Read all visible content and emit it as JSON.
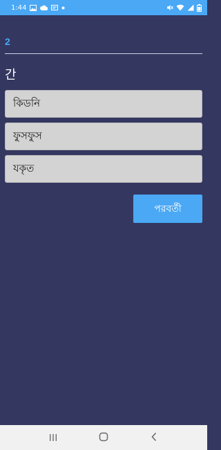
{
  "status_bar": {
    "time": "1:44",
    "left_icons": [
      "image-icon",
      "cloud-icon",
      "notification-icon",
      "dot-icon"
    ],
    "right_icons": [
      "mute-icon",
      "wifi-icon",
      "signal-icon",
      "battery-icon"
    ]
  },
  "quiz": {
    "question_number": "2",
    "question_text": "간",
    "options": [
      {
        "label": "কিডনি"
      },
      {
        "label": "ফুসফুস"
      },
      {
        "label": "যকৃত"
      }
    ],
    "next_label": "পরবর্তী"
  },
  "nav_bar": {
    "buttons": [
      "recent-apps-icon",
      "home-icon",
      "back-icon"
    ]
  },
  "colors": {
    "background": "#343760",
    "accent": "#4aa8f5",
    "option_bg": "#d3d3d3"
  }
}
